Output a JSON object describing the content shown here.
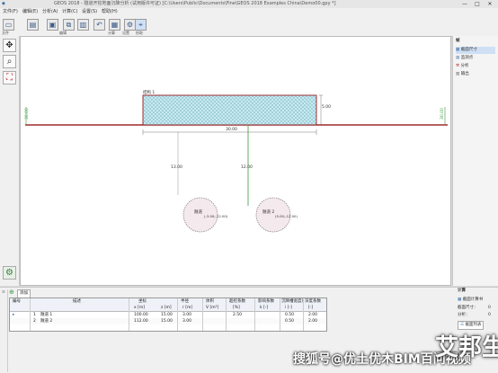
{
  "window": {
    "title": "GEOS 2018 - 隧道开挖地面沉降分析 (试用版许可证) [C:\\Users\\Public\\Documents\\Fine\\GEOS 2018 Examples China\\Demo00.gpy *]",
    "controls": [
      "—",
      "□",
      "✕"
    ]
  },
  "menu": [
    "文件(F)",
    "编辑(E)",
    "分析(A)",
    "计算(C)",
    "设置(S)",
    "帮助(H)"
  ],
  "toolbar": {
    "labels": [
      "文件",
      "编辑",
      "计算",
      "设置",
      "拾取"
    ]
  },
  "left_tools": [
    "move-icon",
    "zoom-icon",
    "fit-icon"
  ],
  "right_panel": {
    "title": "帧",
    "items": [
      "截面尺寸",
      "监测点",
      "分析",
      "输出"
    ]
  },
  "canvas": {
    "structure_label": "结构 1",
    "left_level": "30.00",
    "right_level": "30.00",
    "height_dim": "5.00",
    "width_dim": "30.00",
    "depth_left": "13.00",
    "depth_right": "12.00",
    "tunnel1_label": "隧道",
    "tunnel1_coords": "(-3.00;-12.00)",
    "tunnel2_label": "隧道 2",
    "tunnel2_coords": "(5.00;-12.00)"
  },
  "grid": {
    "tabs": [
      "添加"
    ],
    "header1": [
      "编号",
      "描述",
      "坐标",
      "",
      "半径",
      "体积",
      "超挖系数",
      "影响系数",
      "沉降槽宽度系数",
      "深度系数"
    ],
    "header2": [
      "",
      "",
      "x [m]",
      "z [m]",
      "r [m]",
      "V [m³]",
      "[%]",
      "k [-]",
      "i [-]",
      "[-]"
    ],
    "rows": [
      [
        "1",
        "隧道 1",
        "100.00",
        "15.00",
        "3.00",
        "",
        "2.50",
        "",
        "0.50",
        "2.00"
      ],
      [
        "2",
        "隧道 2",
        "112.00",
        "15.00",
        "3.00",
        "",
        "",
        "",
        "0.50",
        "2.00"
      ]
    ]
  },
  "bottom_right": {
    "title": "计算",
    "items": [
      "截面计算书",
      "截面尺寸：",
      "分析：",
      "截面列表"
    ],
    "values": [
      "",
      "0",
      "0",
      ""
    ]
  },
  "watermark": {
    "caption": "搜狐号@优土优木BIM百问视频",
    "logo": "艾邦生"
  },
  "colors": {
    "ground": "#8b0000",
    "structure_fill": "#c8eaf2",
    "structure_border": "#8b0000",
    "green_dim": "#3c9a3c"
  }
}
